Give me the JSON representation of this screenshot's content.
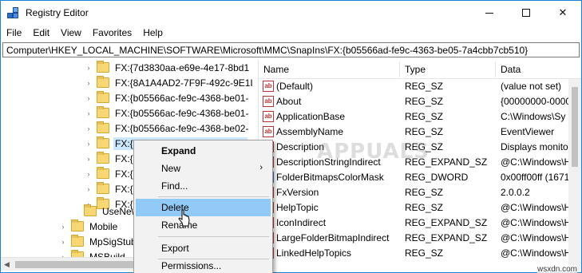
{
  "window": {
    "title": "Registry Editor"
  },
  "menu": [
    "File",
    "Edit",
    "View",
    "Favorites",
    "Help"
  ],
  "address": "Computer\\HKEY_LOCAL_MACHINE\\SOFTWARE\\Microsoft\\MMC\\SnapIns\\FX:{b05566ad-fe9c-4363-be05-7a4cbb7cb510}",
  "tree": [
    {
      "label": "FX:{7d3830aa-e69e-4e17-8bd1",
      "expandable": true,
      "selected": false
    },
    {
      "label": "FX:{8A1A4AD2-7F9F-492c-9E1I",
      "expandable": true,
      "selected": false
    },
    {
      "label": "FX:{b05566ac-fe9c-4368-be01-",
      "expandable": true,
      "selected": false
    },
    {
      "label": "FX:{b05566ac-fe9c-4368-be01-",
      "expandable": true,
      "selected": false
    },
    {
      "label": "FX:{b05566ac-fe9c-4368-be02-",
      "expandable": true,
      "selected": false
    },
    {
      "label": "FX:{b05566ad-fe9c-4363-be05",
      "expandable": true,
      "selected": true
    },
    {
      "label": "FX:{c",
      "expandable": true,
      "selected": false
    },
    {
      "label": "FX:{c",
      "expandable": true,
      "selected": false
    },
    {
      "label": "FX:{c",
      "expandable": true,
      "selected": false
    },
    {
      "label": "FX:{f4",
      "expandable": true,
      "selected": false
    },
    {
      "label": "UseNew",
      "expandable": false,
      "selected": false
    },
    {
      "label": "Mobile",
      "expandable": true,
      "selected": false
    },
    {
      "label": "MpSigStub",
      "expandable": true,
      "selected": false
    },
    {
      "label": "MSBuild",
      "expandable": true,
      "selected": false
    }
  ],
  "list": {
    "columns": [
      "Name",
      "Type",
      "Data"
    ],
    "rows": [
      {
        "icon": "ab",
        "name": "(Default)",
        "type": "REG_SZ",
        "data": "(value not set)"
      },
      {
        "icon": "ab",
        "name": "About",
        "type": "REG_SZ",
        "data": "{00000000-0000"
      },
      {
        "icon": "ab",
        "name": "ApplicationBase",
        "type": "REG_SZ",
        "data": "C:\\Windows\\Sy"
      },
      {
        "icon": "ab",
        "name": "AssemblyName",
        "type": "REG_SZ",
        "data": "EventViewer"
      },
      {
        "icon": "ab",
        "name": "Description",
        "type": "REG_SZ",
        "data": "Displays monito"
      },
      {
        "icon": "ab",
        "name": "DescriptionStringIndirect",
        "type": "REG_EXPAND_SZ",
        "data": "@C:\\Windows\\He"
      },
      {
        "icon": "bin",
        "name": "FolderBitmapsColorMask",
        "type": "REG_DWORD",
        "data": "0x00ff00ff (1671"
      },
      {
        "icon": "ab",
        "name": "FxVersion",
        "type": "REG_SZ",
        "data": "2.0.0.2"
      },
      {
        "icon": "ab",
        "name": "HelpTopic",
        "type": "REG_SZ",
        "data": "@C:\\Windows\\He"
      },
      {
        "icon": "ab",
        "name": "IconIndirect",
        "type": "REG_EXPAND_SZ",
        "data": "@C:\\Windows\\He"
      },
      {
        "icon": "ab",
        "name": "LargeFolderBitmapIndirect",
        "type": "REG_EXPAND_SZ",
        "data": "@C:\\Windows\\He"
      },
      {
        "icon": "ab",
        "name": "LinkedHelpTopics",
        "type": "REG_SZ",
        "data": "@C:\\Windows\\He"
      }
    ]
  },
  "context_menu": {
    "expand": "Expand",
    "new": "New",
    "find": "Find...",
    "delete": "Delete",
    "rename": "Rename",
    "export": "Export",
    "permissions": "Permissions..."
  },
  "watermark": "APPUALS",
  "site": "wsxdn.com"
}
